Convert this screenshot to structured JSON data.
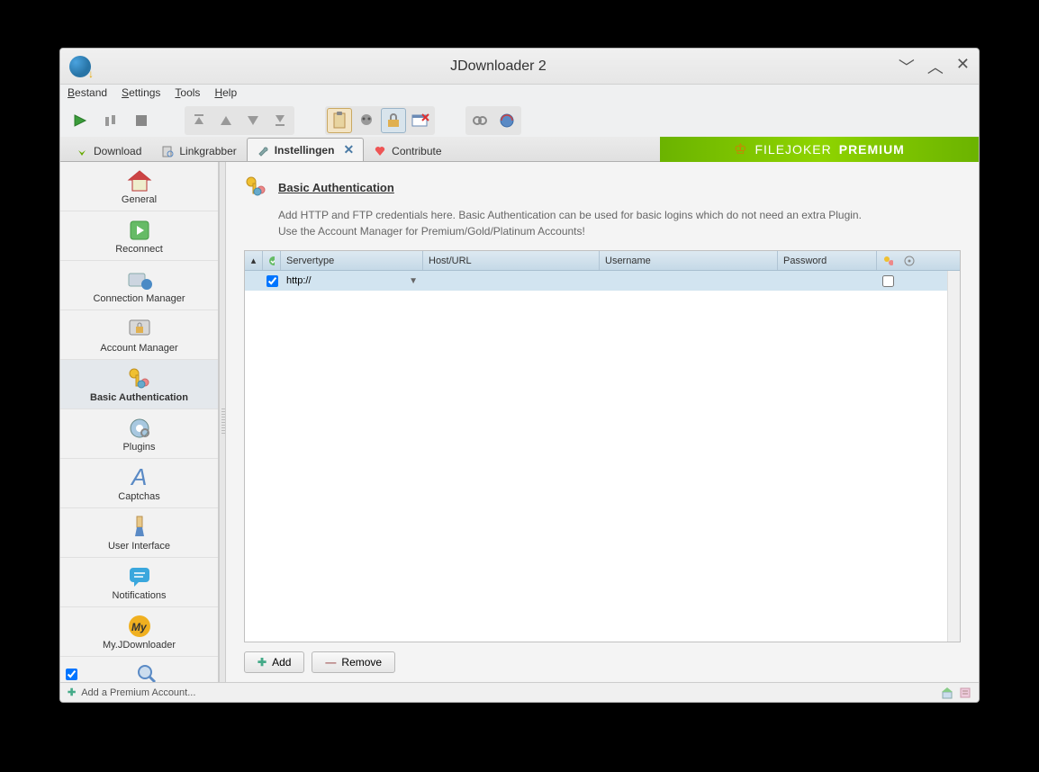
{
  "window": {
    "title": "JDownloader 2"
  },
  "menubar": {
    "items": [
      {
        "label": "Bestand",
        "accel": "B"
      },
      {
        "label": "Settings",
        "accel": "S"
      },
      {
        "label": "Tools",
        "accel": "T"
      },
      {
        "label": "Help",
        "accel": "H"
      }
    ]
  },
  "tabs": {
    "items": [
      {
        "label": "Download",
        "icon": "download-arrow"
      },
      {
        "label": "Linkgrabber",
        "icon": "clipboard-link"
      },
      {
        "label": "Instellingen",
        "icon": "wrench",
        "active": true,
        "closable": true
      },
      {
        "label": "Contribute",
        "icon": "heart"
      }
    ]
  },
  "promo": {
    "brand": "FILEJOKER",
    "tier": "PREMIUM"
  },
  "sidebar": {
    "items": [
      {
        "label": "General",
        "icon": "home"
      },
      {
        "label": "Reconnect",
        "icon": "reconnect"
      },
      {
        "label": "Connection Manager",
        "icon": "connection"
      },
      {
        "label": "Account Manager",
        "icon": "lock-monitor"
      },
      {
        "label": "Basic Authentication",
        "icon": "key-users",
        "selected": true
      },
      {
        "label": "Plugins",
        "icon": "plugin"
      },
      {
        "label": "Captchas",
        "icon": "captcha"
      },
      {
        "label": "User Interface",
        "icon": "brush"
      },
      {
        "label": "Notifications",
        "icon": "speech"
      },
      {
        "label": "My.JDownloader",
        "icon": "myjd"
      },
      {
        "label": "",
        "icon": "magnify",
        "check": true
      }
    ]
  },
  "panel": {
    "title": "Basic Authentication",
    "desc1": "Add HTTP and FTP credentials here. Basic Authentication can be used for basic logins which do not need an extra Plugin.",
    "desc2": "Use the Account Manager for Premium/Gold/Platinum Accounts!",
    "columns": {
      "servertype": "Servertype",
      "host": "Host/URL",
      "username": "Username",
      "password": "Password"
    },
    "rows": [
      {
        "enabled": true,
        "servertype": "http://",
        "host": "",
        "username": "",
        "password": "",
        "locked": false
      }
    ],
    "buttons": {
      "add": "Add",
      "remove": "Remove"
    }
  },
  "statusbar": {
    "left": "Add a Premium Account..."
  }
}
